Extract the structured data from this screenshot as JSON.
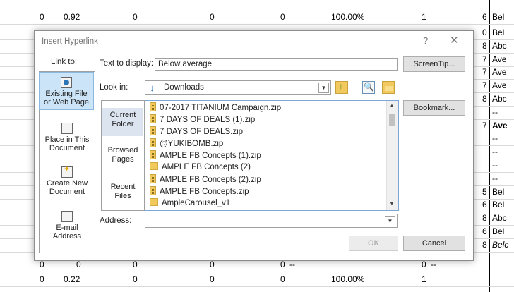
{
  "sheet": {
    "top_row": [
      "0",
      "0.92",
      "0",
      "0",
      "0",
      "100.00%",
      "1",
      "6",
      "Bel"
    ],
    "bottom_row": [
      "0",
      "0",
      "0",
      "0",
      "0",
      "--",
      "0",
      "--"
    ],
    "partial_row": [
      "0",
      "0.22",
      "0",
      "0",
      "0",
      "100.00%",
      "1"
    ],
    "right_col": [
      [
        "0",
        "Bel"
      ],
      [
        "8",
        "Abc"
      ],
      [
        "7",
        "Ave"
      ],
      [
        "7",
        "Ave"
      ],
      [
        "7",
        "Ave"
      ],
      [
        "8",
        "Abc"
      ],
      [
        "",
        "--"
      ],
      [
        "7",
        "Ave"
      ],
      [
        "",
        "--"
      ],
      [
        "",
        "--"
      ],
      [
        "",
        "--"
      ],
      [
        "",
        "--"
      ],
      [
        "5",
        "Bel"
      ],
      [
        "6",
        "Bel"
      ],
      [
        "8",
        "Abc"
      ],
      [
        "6",
        "Bel"
      ],
      [
        "8",
        "Belc"
      ]
    ]
  },
  "dialog": {
    "title": "Insert Hyperlink",
    "help": "?",
    "close": "✕",
    "link_to_label": "Link to:",
    "link_to_items": [
      {
        "label1": "Existing File",
        "label2": "or Web Page"
      },
      {
        "label1": "Place in This",
        "label2": "Document"
      },
      {
        "label1": "Create New",
        "label2": "Document"
      },
      {
        "label1": "E-mail",
        "label2": "Address"
      }
    ],
    "text_to_display_label": "Text to display:",
    "text_to_display_value": "Below average",
    "screentip_label": "ScreenTip...",
    "look_in_label": "Look in:",
    "look_in_value": "Downloads",
    "places": [
      {
        "label1": "Current",
        "label2": "Folder"
      },
      {
        "label1": "Browsed",
        "label2": "Pages"
      },
      {
        "label1": "Recent",
        "label2": "Files"
      }
    ],
    "files": [
      "07-2017 TITANIUM Campaign.zip",
      "7 DAYS OF DEALS (1).zip",
      "7 DAYS OF DEALS.zip",
      "@YUKIBOMB.zip",
      "AMPLE FB Concepts (1).zip",
      "AMPLE FB Concepts (2)",
      "AMPLE FB Concepts (2).zip",
      "AMPLE FB Concepts.zip",
      "AmpleCarousel_v1"
    ],
    "bookmark_label": "Bookmark...",
    "address_label": "Address:",
    "address_value": "",
    "ok_label": "OK",
    "cancel_label": "Cancel"
  }
}
